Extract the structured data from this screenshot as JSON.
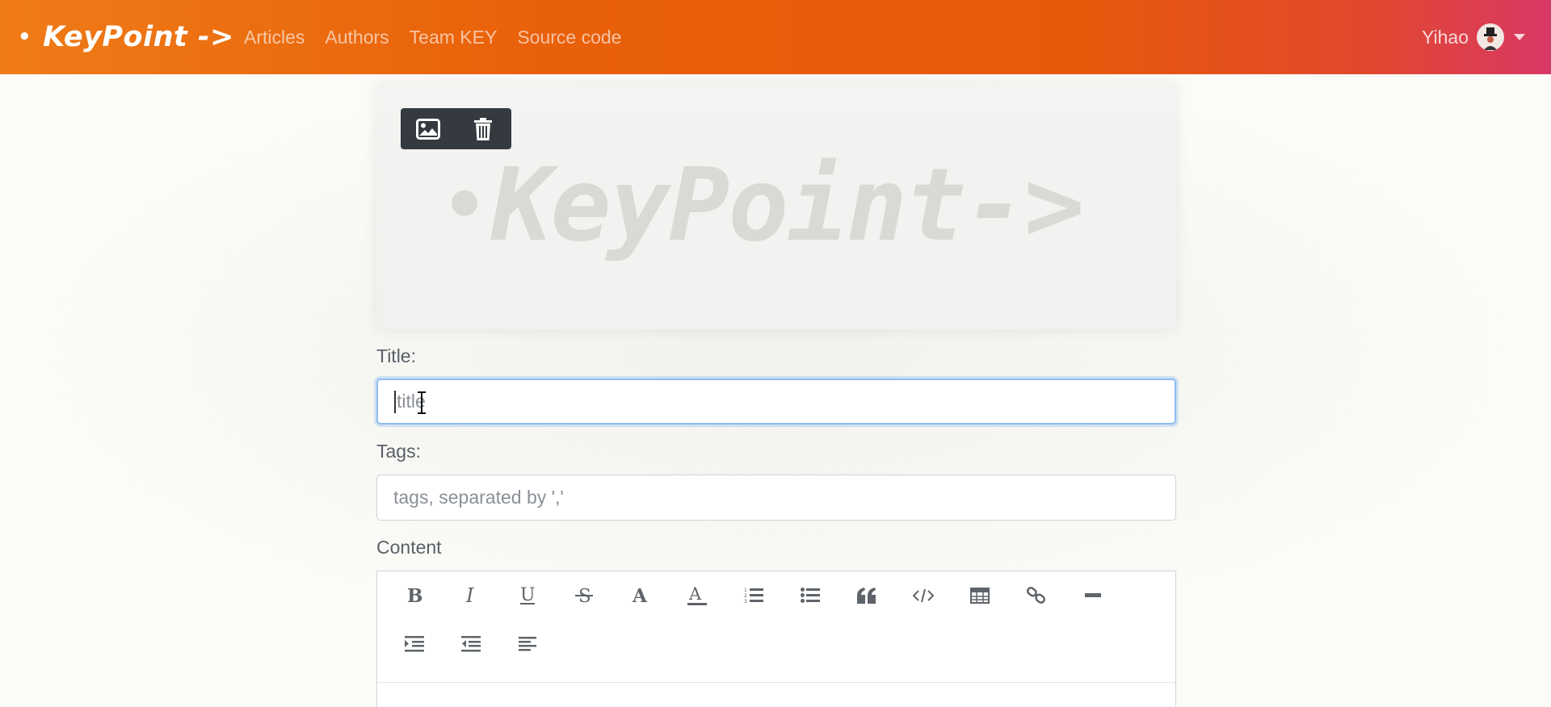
{
  "navbar": {
    "brand": "KeyPoint ->",
    "links": [
      "Articles",
      "Authors",
      "Team KEY",
      "Source code"
    ],
    "user": "Yihao"
  },
  "cover": {
    "logo_text": "KeyPoint->",
    "toolbar": [
      "image-icon",
      "trash-icon"
    ]
  },
  "form": {
    "title_label": "Title:",
    "title_placeholder": "title",
    "tags_label": "Tags:",
    "tags_placeholder": "tags, separated by ','",
    "content_label": "Content"
  },
  "editor": {
    "toolbar_row1": [
      "bold",
      "italic",
      "underline",
      "strikethrough",
      "font-color",
      "background-color",
      "ordered-list",
      "unordered-list",
      "quote",
      "code",
      "table",
      "link",
      "horizontal-rule"
    ],
    "toolbar_row2": [
      "indent",
      "outdent",
      "align-left"
    ]
  }
}
